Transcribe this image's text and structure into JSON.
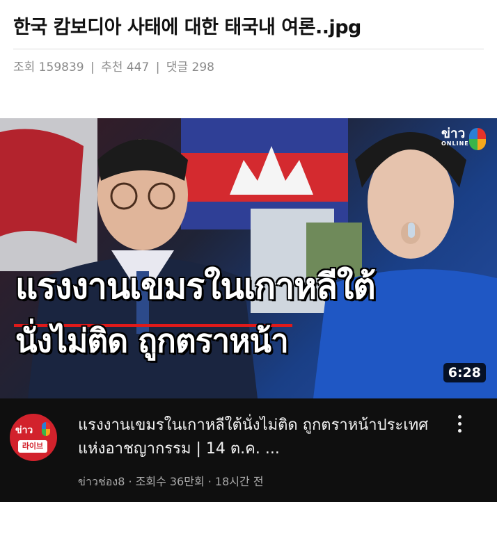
{
  "post": {
    "title": "한국 캄보디아 사태에 대한 태국내 여론..jpg",
    "views_label": "조회 159839",
    "recommend_label": "추천 447",
    "comments_label": "댓글 298",
    "separator": "|"
  },
  "video": {
    "overlay_line1": "แรงงานเขมรในเกาหลีใต้",
    "overlay_line2": "นั่งไม่ติด ถูกตราหน้า",
    "duration": "6:28",
    "corner_logo_main": "ข่าว",
    "corner_logo_sub": "ONLINE",
    "title": "แรงงานเขมรในเกาหลีใต้นั่งไม่ติด ถูกตราหน้าประเทศแห่งอาชญากรรม | 14 ต.ค. ...",
    "meta": "ข่าวช่อง8 · 조회수 36만회 · 18시간 전",
    "avatar_main": "ข่าว",
    "avatar_sub": "라이브",
    "menu_icon": "more-vertical-icon"
  },
  "colors": {
    "card_bg": "#0f0f0f",
    "avatar_red": "#d2222c",
    "title_text": "#f1f1f1",
    "meta_text": "#aaaaaa"
  }
}
